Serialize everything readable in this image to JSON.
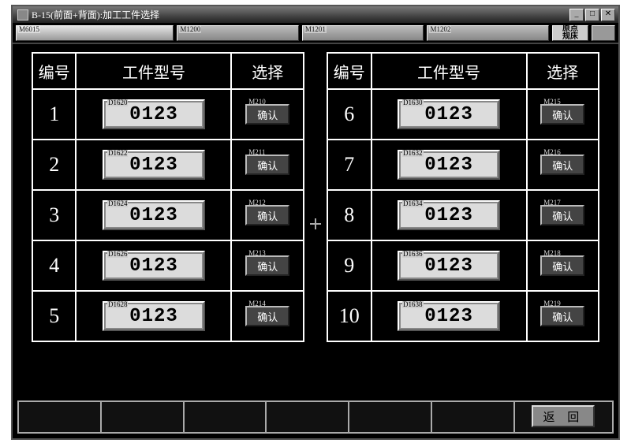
{
  "window": {
    "title": "B-15(前面+背面):加工工件选择"
  },
  "tagrow": {
    "main_tag": "M6015",
    "tags": [
      "M1200",
      "M1201",
      "M1202"
    ],
    "right_label": "原点\n规床"
  },
  "headers": {
    "index": "编号",
    "model": "工件型号",
    "select": "选择"
  },
  "confirm_label": "确认",
  "left_rows": [
    {
      "n": "1",
      "tag": "D1620",
      "val": "0123",
      "btn_tag": "M210"
    },
    {
      "n": "2",
      "tag": "D1622",
      "val": "0123",
      "btn_tag": "M211"
    },
    {
      "n": "3",
      "tag": "D1624",
      "val": "0123",
      "btn_tag": "M212"
    },
    {
      "n": "4",
      "tag": "D1626",
      "val": "0123",
      "btn_tag": "M213"
    },
    {
      "n": "5",
      "tag": "D1628",
      "val": "0123",
      "btn_tag": "M214"
    }
  ],
  "right_rows": [
    {
      "n": "6",
      "tag": "D1630",
      "val": "0123",
      "btn_tag": "M215"
    },
    {
      "n": "7",
      "tag": "D1632",
      "val": "0123",
      "btn_tag": "M216"
    },
    {
      "n": "8",
      "tag": "D1634",
      "val": "0123",
      "btn_tag": "M217"
    },
    {
      "n": "9",
      "tag": "D1636",
      "val": "0123",
      "btn_tag": "M218"
    },
    {
      "n": "10",
      "tag": "D1638",
      "val": "0123",
      "btn_tag": "M219"
    }
  ],
  "footer": {
    "back": "返 回"
  }
}
